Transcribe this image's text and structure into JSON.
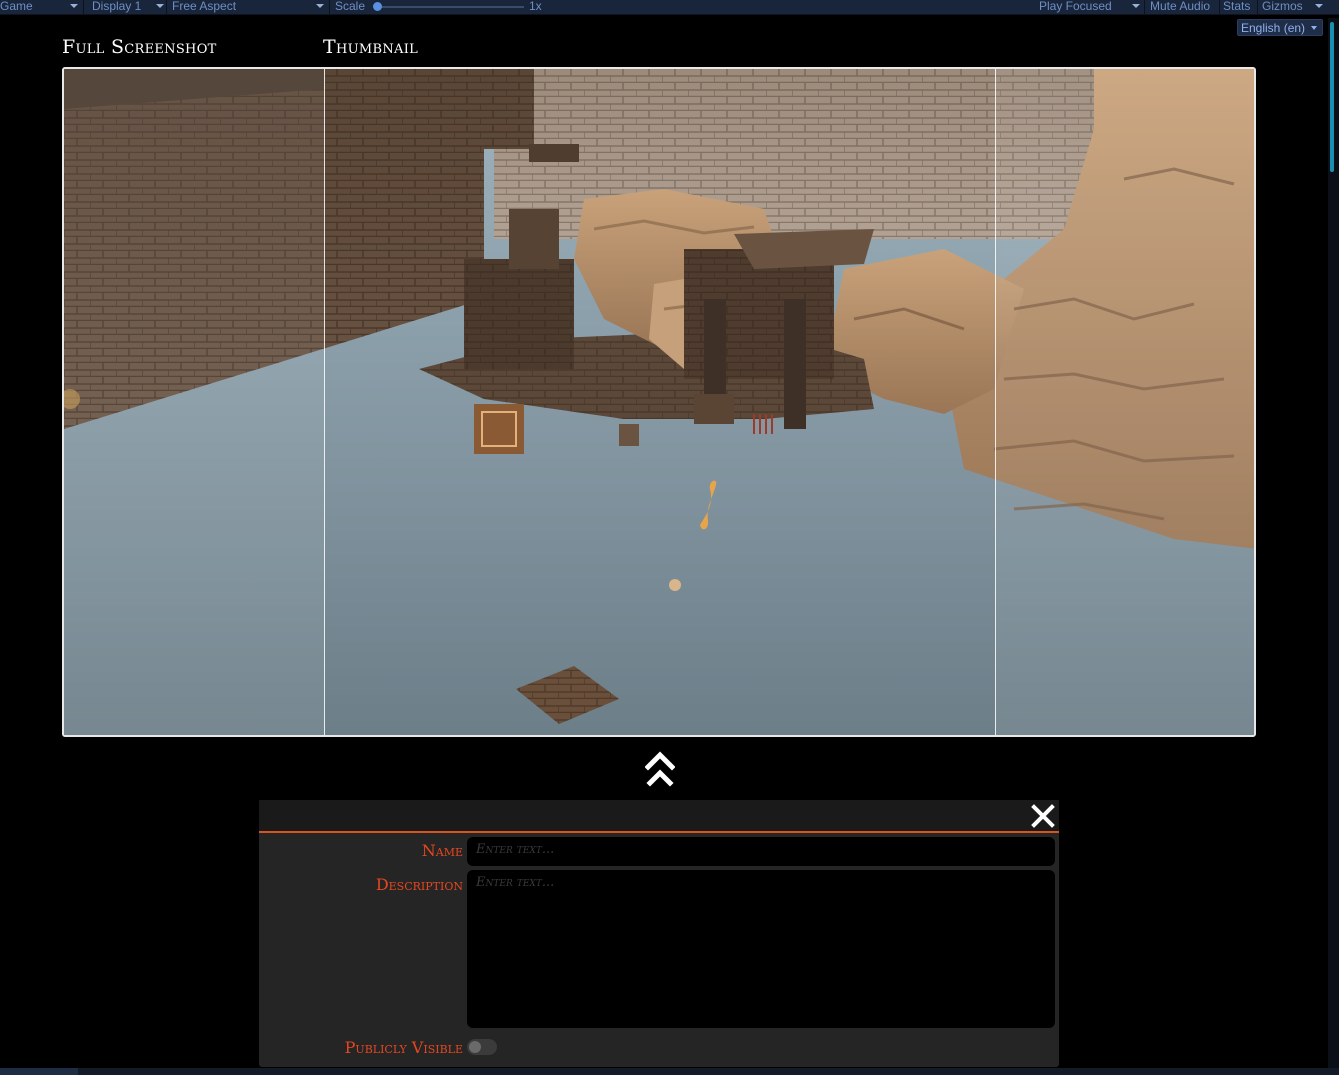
{
  "toolbar": {
    "game_tab": "Game",
    "display": "Display 1",
    "aspect": "Free Aspect",
    "scale_label": "Scale",
    "scale_value": "1x",
    "play_mode": "Play Focused",
    "mute": "Mute Audio",
    "stats": "Stats",
    "gizmos": "Gizmos"
  },
  "language": "English (en)",
  "titles": {
    "full": "Full Screenshot",
    "thumbnail": "Thumbnail"
  },
  "form": {
    "name_label": "Name",
    "name_placeholder": "Enter text...",
    "description_label": "Description",
    "description_placeholder": "Enter text...",
    "public_label": "Publicly Visible",
    "public_value": false
  },
  "colors": {
    "accent": "#e4471f",
    "toolbar": "#19253a",
    "panel": "#252525"
  },
  "icons": [
    "collapse-up-icon",
    "close-icon",
    "dropdown-caret-icon"
  ]
}
